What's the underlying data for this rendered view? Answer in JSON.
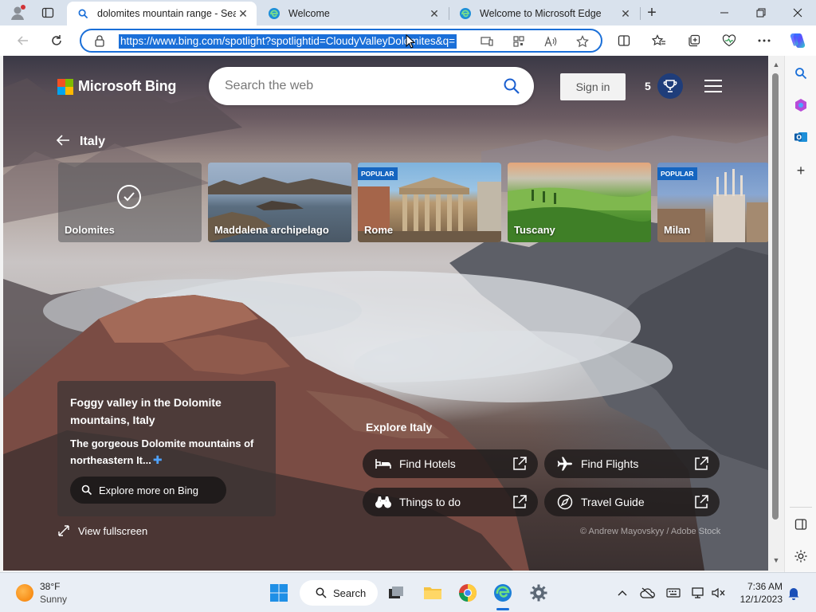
{
  "browser": {
    "tabs": [
      {
        "label": "dolomites mountain range - Sear",
        "active": true
      },
      {
        "label": "Welcome",
        "active": false
      },
      {
        "label": "Welcome to Microsoft Edge",
        "active": false
      }
    ],
    "new_tab_symbol": "+",
    "url": "https://www.bing.com/spotlight?spotlightid=CloudyValleyDolomites&q="
  },
  "bing": {
    "logo_text": "Microsoft Bing",
    "search_placeholder": "Search the web",
    "signin_label": "Sign in",
    "rewards_count": "5",
    "region_title": "Italy",
    "cards": [
      {
        "name": "Dolomites",
        "badge": "",
        "selected": true
      },
      {
        "name": "Maddalena archipelago",
        "badge": ""
      },
      {
        "name": "Rome",
        "badge": "POPULAR"
      },
      {
        "name": "Tuscany",
        "badge": ""
      },
      {
        "name": "Milan",
        "badge": "POPULAR"
      }
    ],
    "info": {
      "title": "Foggy valley in the Dolomite mountains, Italy",
      "description": "The gorgeous Dolomite mountains of northeastern It...",
      "explore_label": "Explore more on Bing",
      "fullscreen_label": "View fullscreen"
    },
    "explore": {
      "title": "Explore Italy",
      "items": [
        {
          "label": "Find Hotels",
          "icon": "bed-icon"
        },
        {
          "label": "Find Flights",
          "icon": "airplane-icon"
        },
        {
          "label": "Things to do",
          "icon": "binoculars-icon"
        },
        {
          "label": "Travel Guide",
          "icon": "compass-icon"
        }
      ]
    },
    "credit": "© Andrew Mayovskyy / Adobe Stock"
  },
  "taskbar": {
    "weather_temp": "38°F",
    "weather_condition": "Sunny",
    "search_label": "Search",
    "time": "7:36 AM",
    "date": "12/1/2023"
  },
  "colors": {
    "accent": "#1a6fd8",
    "badge_blue": "#1565c0",
    "tab_strip": "#d9e2ed"
  }
}
